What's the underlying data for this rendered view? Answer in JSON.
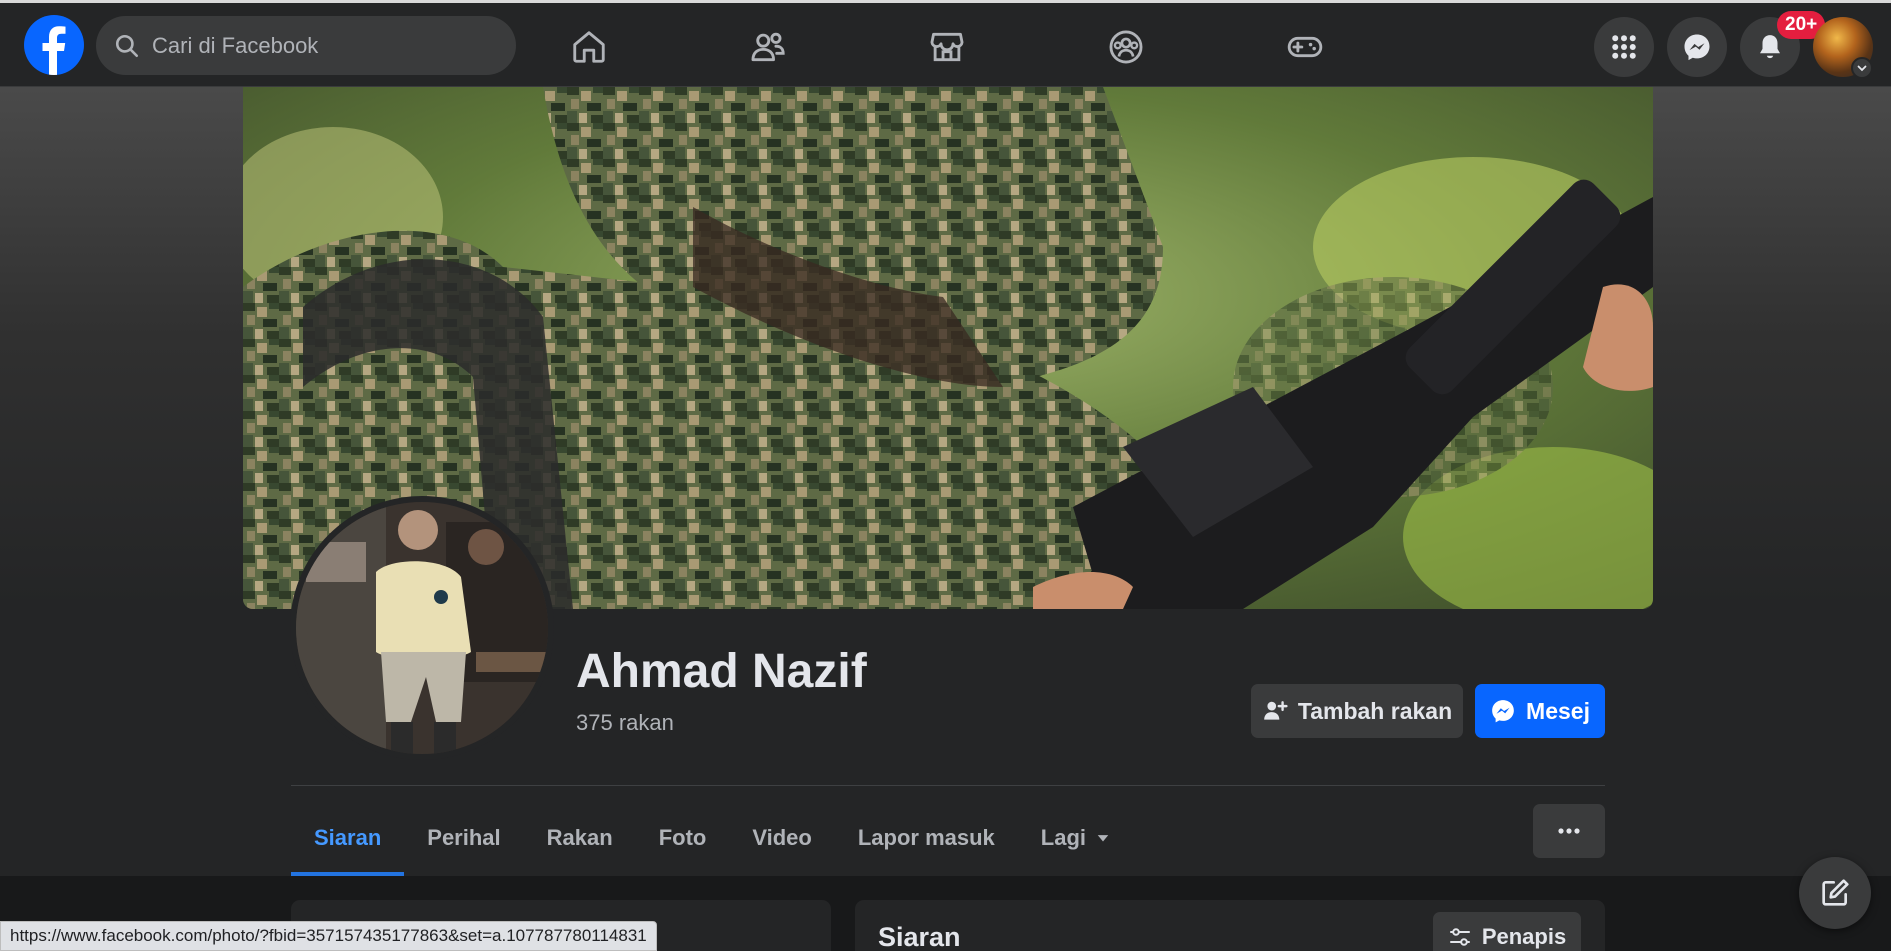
{
  "topbar": {
    "search_placeholder": "Cari di Facebook",
    "nav_icons": [
      "home-icon",
      "friends-icon",
      "marketplace-icon",
      "groups-icon",
      "gaming-icon"
    ],
    "notification_badge": "20+",
    "accent_color": "#0866ff",
    "badge_color": "#e41e3f"
  },
  "profile": {
    "name": "Ahmad Nazif",
    "friends": "375 rakan",
    "add_friend_label": "Tambah rakan",
    "message_label": "Mesej"
  },
  "tabs": [
    {
      "label": "Siaran",
      "active": true
    },
    {
      "label": "Perihal"
    },
    {
      "label": "Rakan"
    },
    {
      "label": "Foto"
    },
    {
      "label": "Video"
    },
    {
      "label": "Lapor masuk"
    },
    {
      "label": "Lagi"
    }
  ],
  "content": {
    "posts_title": "Siaran",
    "filter_label": "Penapis"
  },
  "status_bar": {
    "url": "https://www.facebook.com/photo/?fbid=357157435177863&set=a.107787780114831"
  }
}
